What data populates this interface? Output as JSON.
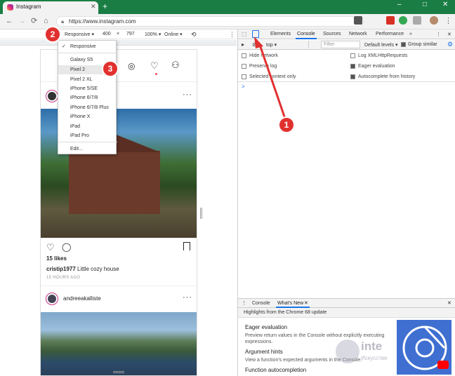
{
  "browser": {
    "tab_title": "Instagram",
    "new_tab": "+",
    "url": "https://www.instagram.com",
    "window_controls": [
      "–",
      "□",
      "✕"
    ]
  },
  "device_toolbar": {
    "device": "Responsive",
    "width": "400",
    "times": "×",
    "height": "797",
    "zoom": "100%",
    "network": "Online"
  },
  "device_menu": {
    "items": [
      "Responsive",
      "Galaxy S5",
      "Pixel 2",
      "Pixel 2 XL",
      "iPhone 5/SE",
      "iPhone 6/7/8",
      "iPhone 6/7/8 Plus",
      "iPhone X",
      "iPad",
      "iPad Pro",
      "Edit..."
    ],
    "selected": "Pixel 2",
    "checked": "Responsive"
  },
  "annotations": [
    "1",
    "2",
    "3"
  ],
  "instagram": {
    "post1": {
      "likes": "15 likes",
      "user": "cristip1977",
      "caption": "Little cozy house",
      "time": "15 HOURS AGO"
    },
    "post2": {
      "user": "andreeakalliste"
    }
  },
  "devtools": {
    "tabs": [
      "Elements",
      "Console",
      "Sources",
      "Network",
      "Performance"
    ],
    "active_tab": "Console",
    "context": "top",
    "filter_placeholder": "Filter",
    "levels": "Default levels",
    "group_similar": "Group similar",
    "settings_left": [
      "Hide network",
      "Preserve log",
      "Selected context only"
    ],
    "settings_right": [
      "Log XMLHttpRequests",
      "Eager evaluation",
      "Autocomplete from history"
    ],
    "prompt": ">",
    "drawer_tabs": [
      "Console",
      "What's New"
    ],
    "drawer_active": "What's New",
    "banner": "Highlights from the Chrome 68 update",
    "features": [
      {
        "title": "Eager evaluation",
        "desc": "Preview return values in the Console without explicitly executing expressions."
      },
      {
        "title": "Argument hints",
        "desc": "View a function's expected arguments in the Console."
      },
      {
        "title": "Function autocompletion",
        "desc": ""
      }
    ]
  },
  "watermark": {
    "line1": "inte",
    "line2": "Искусстве"
  },
  "colors": {
    "chrome_tabbar": "#1a7e44",
    "annotation_red": "#e1312f",
    "devtools_blue": "#1a73e8"
  }
}
